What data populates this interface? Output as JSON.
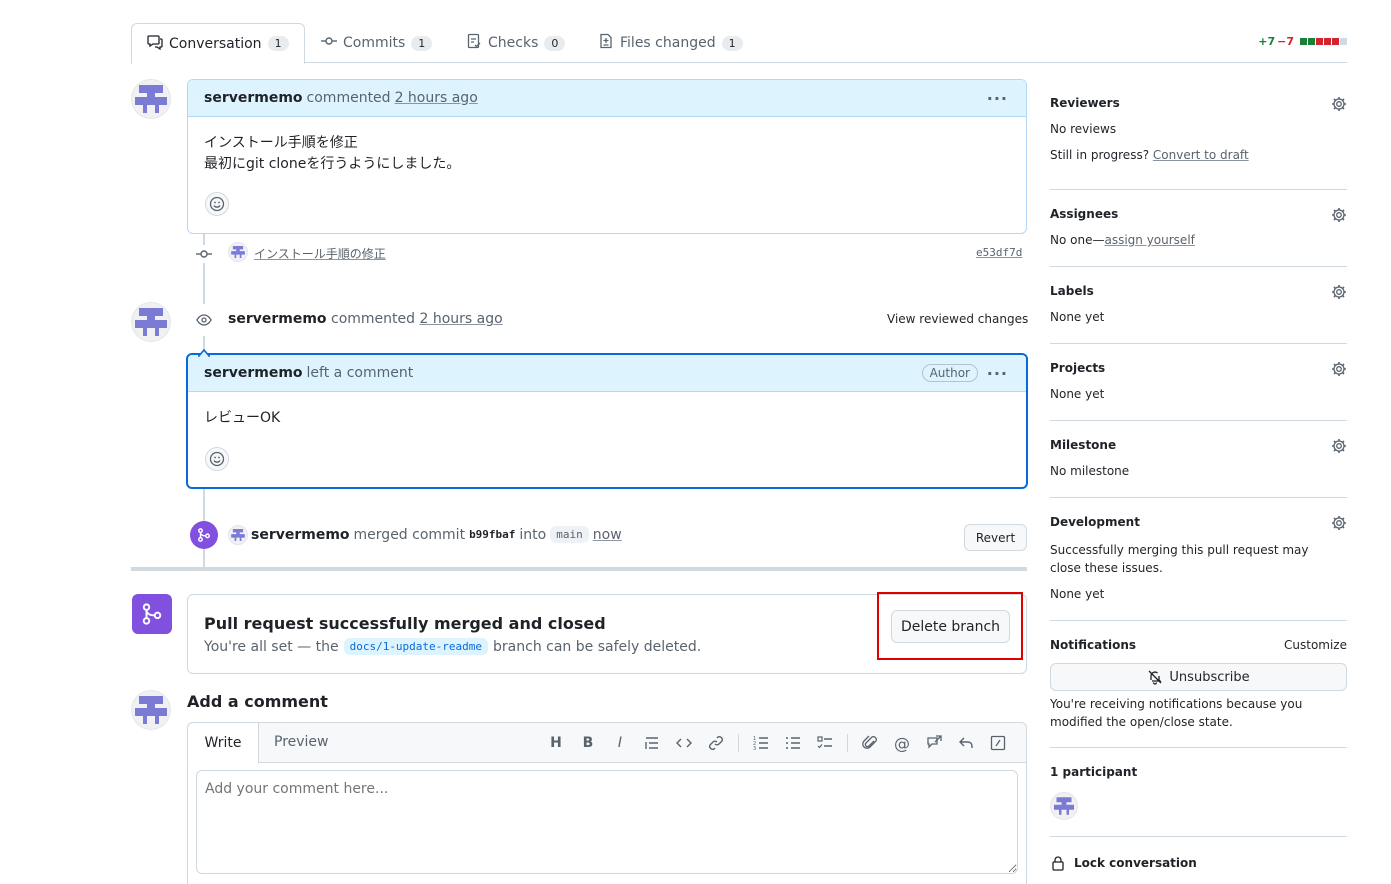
{
  "tabs": [
    {
      "label": "Conversation",
      "count": "1"
    },
    {
      "label": "Commits",
      "count": "1"
    },
    {
      "label": "Checks",
      "count": "0"
    },
    {
      "label": "Files changed",
      "count": "1"
    }
  ],
  "diffstat": {
    "additions": "+7",
    "deletions": "−7",
    "colors": [
      "#1a7f37",
      "#1a7f37",
      "#d1242f",
      "#d1242f",
      "#d1242f",
      "#d1d9e0"
    ]
  },
  "comment1": {
    "author": "servermemo",
    "action": "commented",
    "time": "2 hours ago",
    "line1": "インストール手順を修正",
    "line2": "最初にgit cloneを行うようにしました。"
  },
  "commit_event": {
    "message": "インストール手順の修正",
    "sha": "e53df7d"
  },
  "review": {
    "author": "servermemo",
    "action": "commented",
    "time": "2 hours ago",
    "view_changes": "View reviewed changes",
    "inner_author": "servermemo",
    "inner_action": "left a comment",
    "badge": "Author",
    "body": "レビューOK"
  },
  "merge_event": {
    "author": "servermemo",
    "action": "merged commit",
    "sha": "b99fbaf",
    "into": "into",
    "branch": "main",
    "time": "now",
    "revert": "Revert"
  },
  "merged_box": {
    "title": "Pull request successfully merged and closed",
    "text_before": "You're all set — the",
    "branch": "docs/1-update-readme",
    "text_after": "branch can be safely deleted.",
    "delete_button": "Delete branch",
    "highlight_color": "#e00000"
  },
  "add_comment": {
    "title": "Add a comment",
    "write_tab": "Write",
    "preview_tab": "Preview",
    "placeholder": "Add your comment here..."
  },
  "sidebar": {
    "reviewers": {
      "title": "Reviewers",
      "value": "No reviews",
      "progress_text": "Still in progress?",
      "convert_link": "Convert to draft"
    },
    "assignees": {
      "title": "Assignees",
      "value": "No one—",
      "assign_link": "assign yourself"
    },
    "labels": {
      "title": "Labels",
      "value": "None yet"
    },
    "projects": {
      "title": "Projects",
      "value": "None yet"
    },
    "milestone": {
      "title": "Milestone",
      "value": "No milestone"
    },
    "development": {
      "title": "Development",
      "text": "Successfully merging this pull request may close these issues.",
      "value": "None yet"
    },
    "notifications": {
      "title": "Notifications",
      "customize": "Customize",
      "unsubscribe": "Unsubscribe",
      "reason": "You're receiving notifications because you modified the open/close state."
    },
    "participants": {
      "title": "1 participant"
    },
    "lock": {
      "label": "Lock conversation"
    }
  },
  "colors": {
    "accent": "#0969da",
    "merged": "#8250df",
    "border": "#d1d9e0"
  }
}
